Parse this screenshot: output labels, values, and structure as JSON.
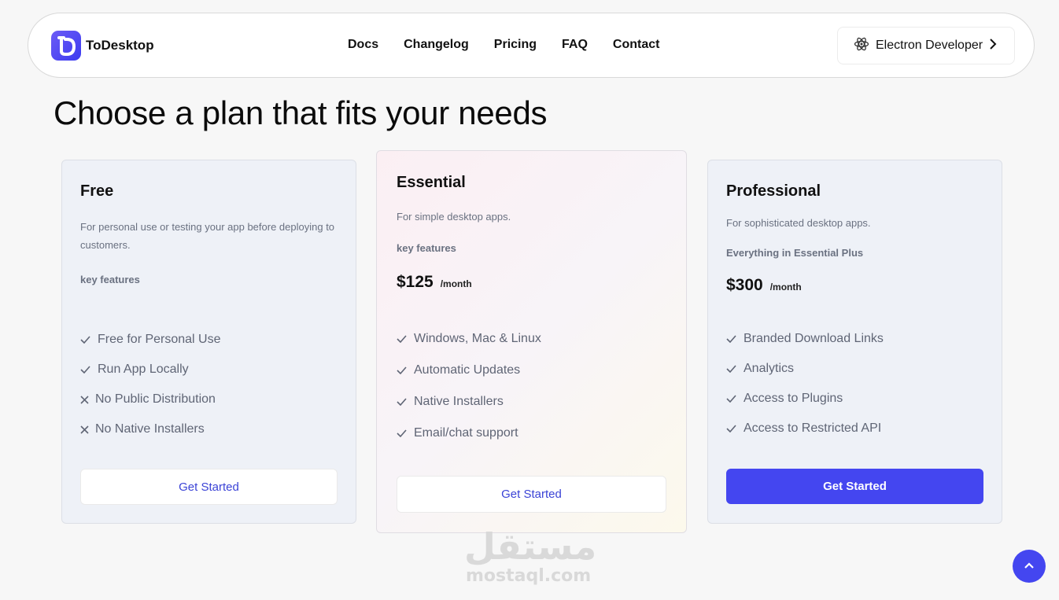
{
  "header": {
    "logo_text": "ToDesktop",
    "nav": [
      "Docs",
      "Changelog",
      "Pricing",
      "FAQ",
      "Contact"
    ],
    "electron_button": "Electron Developer"
  },
  "title": "Choose a plan that fits your needs",
  "plans": [
    {
      "name": "Free",
      "description": "For personal use or testing your app before deploying to customers.",
      "key_label": "key features",
      "features": [
        {
          "text": "Free for Personal Use",
          "included": true
        },
        {
          "text": "Run App Locally",
          "included": true
        },
        {
          "text": "No Public Distribution",
          "included": false
        },
        {
          "text": "No Native Installers",
          "included": false
        }
      ],
      "cta": "Get Started"
    },
    {
      "name": "Essential",
      "description": "For simple desktop apps.",
      "key_label": "key features",
      "price": "$125",
      "period": "/month",
      "features": [
        {
          "text": "Windows, Mac & Linux",
          "included": true
        },
        {
          "text": "Automatic Updates",
          "included": true
        },
        {
          "text": "Native Installers",
          "included": true
        },
        {
          "text": "Email/chat support",
          "included": true
        }
      ],
      "cta": "Get Started"
    },
    {
      "name": "Professional",
      "description": "For sophisticated desktop apps.",
      "key_label": "Everything in Essential Plus",
      "price": "$300",
      "period": "/month",
      "features": [
        {
          "text": "Branded Download Links",
          "included": true
        },
        {
          "text": "Analytics",
          "included": true
        },
        {
          "text": "Access to Plugins",
          "included": true
        },
        {
          "text": "Access to Restricted API",
          "included": true
        }
      ],
      "cta": "Get Started"
    }
  ],
  "watermark": {
    "arabic": "مستقل",
    "latin": "mostaql.com"
  },
  "colors": {
    "accent": "#4446f0",
    "card_bg": "#eef1f7",
    "muted_text": "#6a7181"
  }
}
